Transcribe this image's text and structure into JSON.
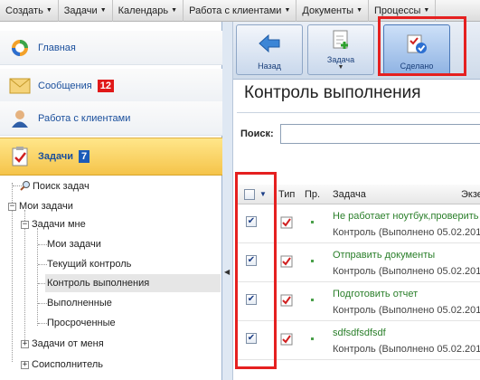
{
  "menu": [
    "Создать",
    "Задачи",
    "Календарь",
    "Работа с клиентами",
    "Документы",
    "Процессы"
  ],
  "nav": {
    "home": "Главная",
    "messages": "Сообщения",
    "messages_badge": "12",
    "clients": "Работа с клиентами",
    "tasks": "Задачи",
    "tasks_badge": "7"
  },
  "tree": {
    "search": "Поиск задач",
    "my_tasks": "Мои задачи",
    "tasks_to_me": "Задачи мне",
    "my_tasks_sub": "Мои задачи",
    "current_control": "Текущий контроль",
    "execution_control": "Контроль выполнения",
    "completed": "Выполненные",
    "overdue": "Просроченные",
    "tasks_from_me": "Задачи от меня",
    "co_executor": "Соисполнитель"
  },
  "toolbar": {
    "back": "Назад",
    "task": "Задача",
    "done": "Сделано"
  },
  "page_title": "Контроль выполнения",
  "search": {
    "label": "Поиск:",
    "value": ""
  },
  "grid": {
    "columns": [
      "Тип",
      "Пр.",
      "Задача",
      "Экзе"
    ],
    "rows": [
      {
        "title": "Не работает ноутбук,проверить",
        "sub": "Контроль (Выполнено 05.02.201",
        "checked": true
      },
      {
        "title": "Отправить документы",
        "sub": "Контроль (Выполнено 05.02.201",
        "checked": true
      },
      {
        "title": "Подготовить отчет",
        "sub": "Контроль (Выполнено 05.02.201",
        "checked": true
      },
      {
        "title": "sdfsdfsdfsdf",
        "sub": "Контроль (Выполнено 05.02.201",
        "checked": true
      }
    ]
  },
  "colors": {
    "highlight": "#e52020",
    "active_nav": "#f5c44a",
    "link": "#1a4f9c"
  },
  "icons": [
    "home-icon",
    "messages-icon",
    "clients-icon",
    "tasks-icon",
    "search-icon",
    "back-arrow-icon",
    "new-task-icon",
    "done-icon",
    "task-type-icon"
  ]
}
